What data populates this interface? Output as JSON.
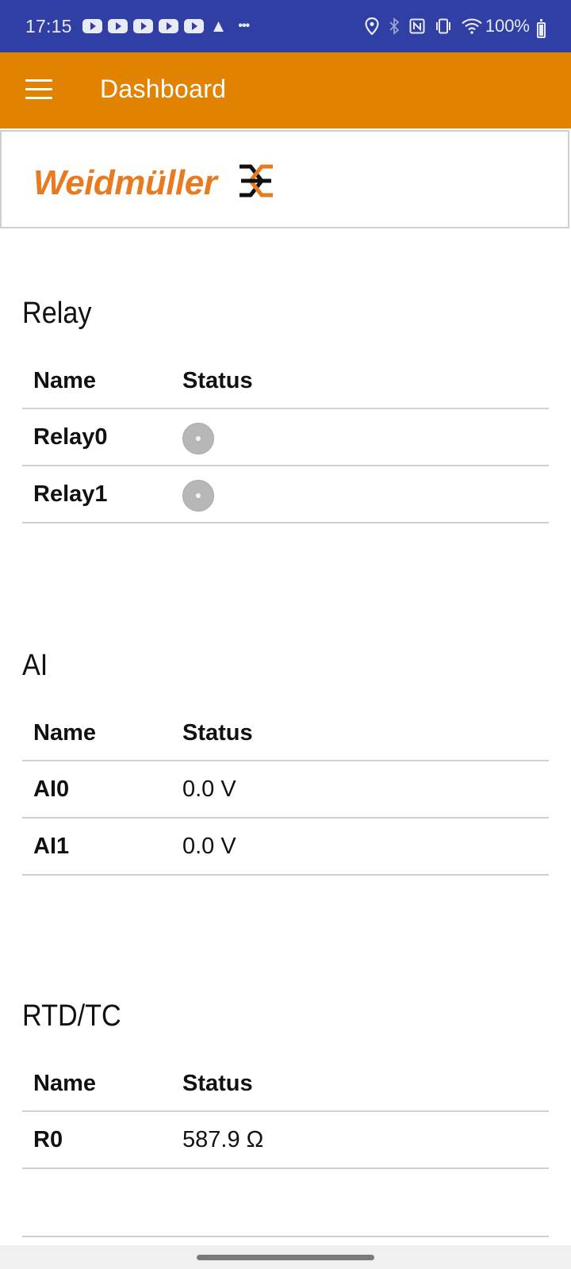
{
  "status_bar": {
    "time": "17:15",
    "notification_icons": [
      "youtube-icon",
      "youtube-icon",
      "youtube-icon",
      "youtube-icon",
      "youtube-icon",
      "warning-icon",
      "more-icon"
    ],
    "system_icons": [
      "location-icon",
      "bluetooth-icon",
      "nfc-icon",
      "vibrate-icon",
      "wifi-icon",
      "battery-icon"
    ],
    "battery": "100%",
    "background_color": "#2f3fa3"
  },
  "app_bar": {
    "title": "Dashboard",
    "menu_icon": "hamburger-menu-icon",
    "background_color": "#e18300"
  },
  "logo": {
    "brand": "Weidmüller",
    "brand_color": "#e87a1f",
    "mark_icon": "weidmuller-logo-mark"
  },
  "sections": [
    {
      "title": "Relay",
      "headers": {
        "name": "Name",
        "status": "Status"
      },
      "rows": [
        {
          "name": "Relay0",
          "status": "off",
          "status_icon": "relay-indicator-icon"
        },
        {
          "name": "Relay1",
          "status": "off",
          "status_icon": "relay-indicator-icon"
        }
      ]
    },
    {
      "title": "AI",
      "headers": {
        "name": "Name",
        "status": "Status"
      },
      "rows": [
        {
          "name": "AI0",
          "status": "0.0 V"
        },
        {
          "name": "AI1",
          "status": "0.0 V"
        }
      ]
    },
    {
      "title": "RTD/TC",
      "headers": {
        "name": "Name",
        "status": "Status"
      },
      "rows": [
        {
          "name": "R0",
          "status": "587.9 Ω"
        }
      ]
    }
  ]
}
